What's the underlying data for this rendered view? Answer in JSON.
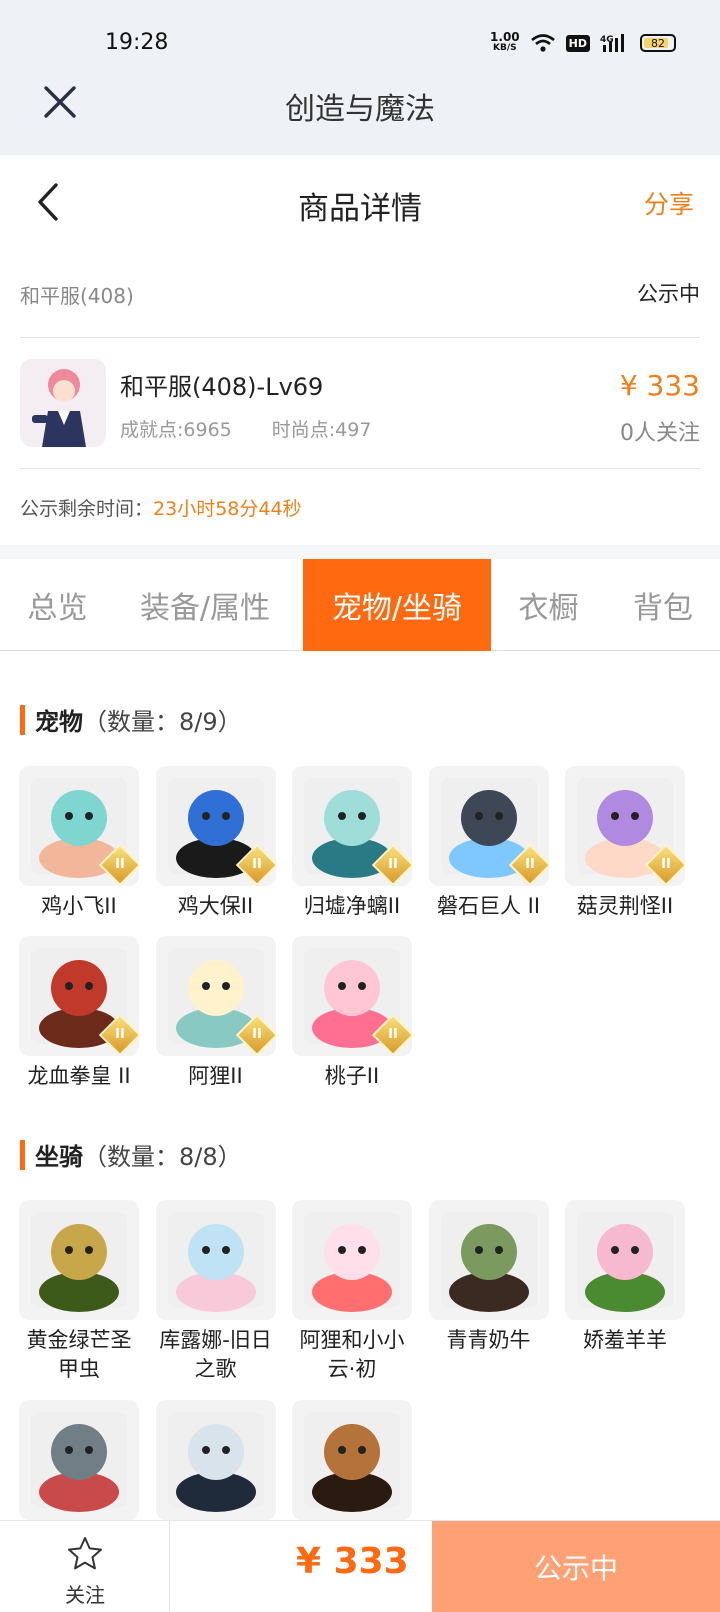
{
  "status_bar": {
    "time": "19:28",
    "net_speed_value": "1.00",
    "net_speed_unit": "KB/S",
    "hd": "HD",
    "signal": "4G",
    "battery": "82"
  },
  "app_bar": {
    "title": "创造与魔法"
  },
  "page_header": {
    "title": "商品详情",
    "share": "分享"
  },
  "listing": {
    "server_name": "和平服(408)",
    "status": "公示中",
    "title": "和平服(408)-Lv69",
    "achievement": "成就点:6965",
    "fashion": "时尚点:497",
    "price": "¥ 333",
    "followers": "0人关注",
    "countdown_label": "公示剩余时间：",
    "countdown_value": "23小时58分44秒"
  },
  "tabs": [
    "总览",
    "装备/属性",
    "宠物/坐骑",
    "衣橱",
    "背包"
  ],
  "active_tab": "宠物/坐骑",
  "pets": {
    "title": "宠物",
    "count": "（数量：8/9）",
    "items": [
      "鸡小飞II",
      "鸡大保II",
      "归墟净螭II",
      "磐石巨人 II",
      "菇灵荆怪II",
      "龙血拳皇 II",
      "阿狸II",
      "桃子II"
    ]
  },
  "mounts": {
    "title": "坐骑",
    "count": "（数量：8/8）",
    "items": [
      "黄金绿芒圣甲虫",
      "库露娜-旧日之歌",
      "阿狸和小小云·初",
      "青青奶牛",
      "娇羞羊羊",
      "",
      "",
      ""
    ]
  },
  "badge_text": "II",
  "bottom_bar": {
    "follow_label": "关注",
    "price": "¥ 333",
    "action": "公示中"
  },
  "colors": {
    "accent": "#ff6a10",
    "price": "#ef7f1a",
    "action_button": "#ffa174"
  }
}
